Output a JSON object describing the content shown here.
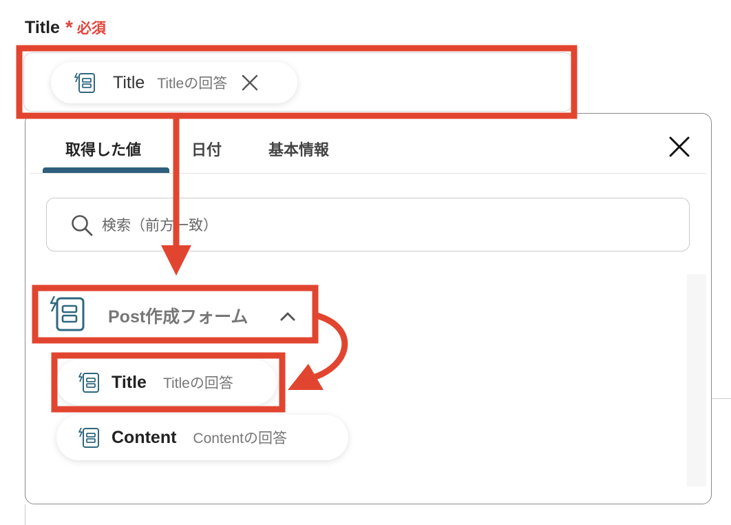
{
  "field": {
    "label": "Title",
    "required_mark": "*",
    "required_text": "必須"
  },
  "selected_chip": {
    "title": "Title",
    "subtitle": "Titleの回答",
    "icon": "form-doc-icon",
    "remove_icon": "close-icon"
  },
  "popup": {
    "tabs": [
      {
        "label": "取得した値",
        "active": true
      },
      {
        "label": "日付",
        "active": false
      },
      {
        "label": "基本情報",
        "active": false
      }
    ],
    "close_icon": "close-icon",
    "search": {
      "placeholder": "検索（前方一致）",
      "value": "",
      "icon": "search-icon"
    },
    "group": {
      "label": "Post作成フォーム",
      "icon": "form-doc-icon",
      "expanded": true,
      "toggle_icon": "chevron-up-icon",
      "items": [
        {
          "title": "Title",
          "subtitle": "Titleの回答",
          "icon": "form-doc-icon"
        },
        {
          "title": "Content",
          "subtitle": "Contentの回答",
          "icon": "form-doc-icon"
        }
      ]
    }
  },
  "colors": {
    "accent": "#2e5f7c",
    "required": "#e2453c",
    "annotation": "#e2452f",
    "icon": "#2e6780"
  }
}
